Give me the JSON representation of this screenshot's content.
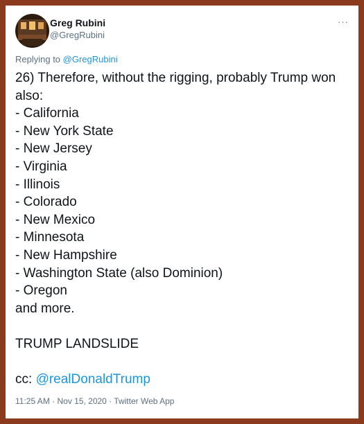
{
  "tweet": {
    "author_name": "Greg Rubini",
    "author_handle": "@GregRubini",
    "more_label": "···",
    "reply_prefix": "Replying to ",
    "reply_to": "@GregRubini",
    "lines": [
      "26) Therefore, without the rigging, probably Trump won",
      "also:",
      "- California",
      "- New York State",
      "- New Jersey",
      "- Virginia",
      "- Illinois",
      "- Colorado",
      "- New Mexico",
      "- Minnesota",
      "- New Hampshire",
      "- Washington State (also Dominion)",
      "- Oregon",
      "and more.",
      "",
      "TRUMP LANDSLIDE",
      ""
    ],
    "cc_prefix": "cc: ",
    "cc_mention": "@realDonaldTrump",
    "timestamp": "11:25 AM · Nov 15, 2020 · Twitter Web App"
  },
  "colors": {
    "frame_border": "#8b3a1e",
    "link_blue": "#1b95e0",
    "muted_gray": "#5b7083",
    "text_dark": "#0f1419"
  }
}
